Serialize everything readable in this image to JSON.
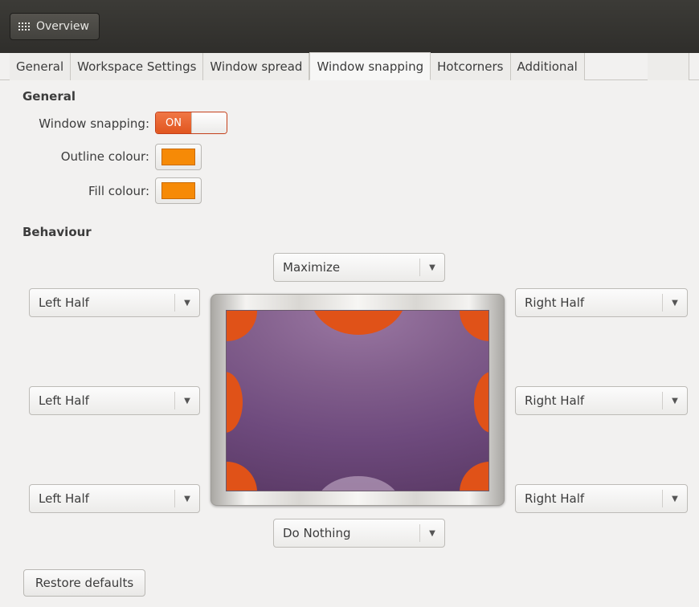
{
  "header": {
    "overview_label": "Overview"
  },
  "tabs": [
    {
      "label": "General"
    },
    {
      "label": "Workspace Settings"
    },
    {
      "label": "Window spread"
    },
    {
      "label": "Window snapping"
    },
    {
      "label": "Hotcorners"
    },
    {
      "label": "Additional"
    }
  ],
  "active_tab": "Window snapping",
  "general": {
    "title": "General",
    "snapping_label": "Window snapping:",
    "snapping_state": "ON",
    "outline_label": "Outline colour:",
    "outline_color": "#f68a06",
    "fill_label": "Fill colour:",
    "fill_color": "#f68a06"
  },
  "behaviour": {
    "title": "Behaviour",
    "top": "Maximize",
    "bottom": "Do Nothing",
    "left_top": "Left Half",
    "left_middle": "Left Half",
    "left_bottom": "Left Half",
    "right_top": "Right Half",
    "right_middle": "Right Half",
    "right_bottom": "Right Half"
  },
  "restore_label": "Restore defaults",
  "colors": {
    "accent": "#e05218",
    "header_bg": "#3c3b37",
    "screen": "#7a5787"
  }
}
